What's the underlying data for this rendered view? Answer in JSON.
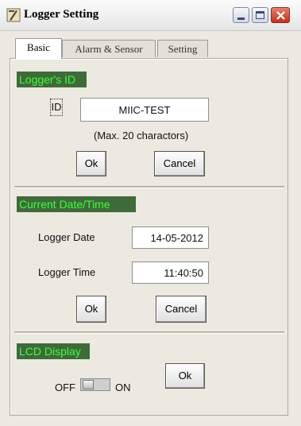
{
  "window": {
    "title": "Logger Setting"
  },
  "tabs": [
    {
      "label": "Basic"
    },
    {
      "label": "Alarm & Sensor"
    },
    {
      "label": "Setting"
    }
  ],
  "logger_id": {
    "section_title": "Logger's ID",
    "label": "ID",
    "value": "MIIC-TEST",
    "hint": "(Max. 20 charactors)",
    "ok_label": "Ok",
    "cancel_label": "Cancel"
  },
  "datetime": {
    "section_title": "Current Date/Time",
    "date_label": "Logger Date",
    "date_value": "14-05-2012",
    "time_label": "Logger Time",
    "time_value": "11:40:50",
    "ok_label": "Ok",
    "cancel_label": "Cancel"
  },
  "lcd": {
    "section_title": "LCD Display",
    "off_label": "OFF",
    "on_label": "ON",
    "state": "OFF",
    "ok_label": "Ok"
  },
  "colors": {
    "section_bg": "#3f6a3a",
    "section_text": "#3cff3c"
  },
  "icons": {
    "app": "logger-app-icon",
    "minimize": "minimize-icon",
    "maximize": "maximize-icon",
    "close": "close-icon"
  }
}
